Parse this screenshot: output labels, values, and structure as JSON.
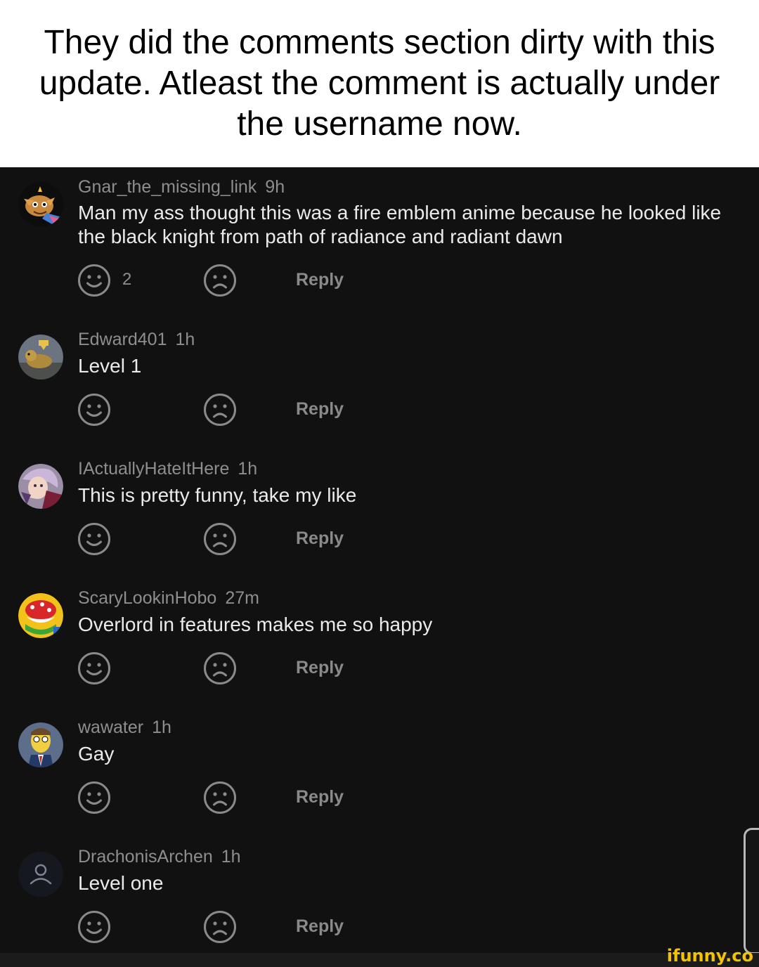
{
  "caption": "They did the comments section dirty with this update. Atleast the comment is actually under the username now.",
  "comments": [
    {
      "username": "Gnar_the_missing_link",
      "time": "9h",
      "text": "Man my ass thought this was a fire emblem anime because he looked like the black knight from path of radiance and radiant dawn",
      "likes": "2",
      "reply_label": "Reply",
      "avatar_icon": "gnar-avatar"
    },
    {
      "username": "Edward401",
      "time": "1h",
      "text": "Level 1",
      "likes": "",
      "reply_label": "Reply",
      "avatar_icon": "creature-avatar"
    },
    {
      "username": "IActuallyHateItHere",
      "time": "1h",
      "text": "This is pretty funny, take my like",
      "likes": "",
      "reply_label": "Reply",
      "avatar_icon": "anime-avatar"
    },
    {
      "username": "ScaryLookinHobo",
      "time": "27m",
      "text": "Overlord in features makes me so happy",
      "likes": "",
      "reply_label": "Reply",
      "avatar_icon": "piranha-avatar"
    },
    {
      "username": "wawater",
      "time": "1h",
      "text": "Gay",
      "likes": "",
      "reply_label": "Reply",
      "avatar_icon": "cartoon-avatar"
    },
    {
      "username": "DrachonisArchen",
      "time": "1h",
      "text": "Level one",
      "likes": "",
      "reply_label": "Reply",
      "avatar_icon": "default-user-avatar"
    }
  ],
  "watermark": "ifunny.co",
  "colors": {
    "background": "#111112",
    "text": "#ebebeb",
    "meta": "#8e8e90",
    "icon": "#8a8a8c",
    "watermark": "#f3c300"
  }
}
